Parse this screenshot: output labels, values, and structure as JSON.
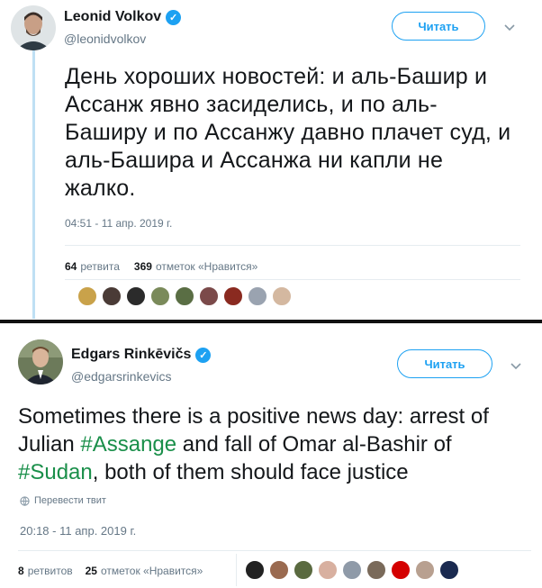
{
  "tweet1": {
    "name": "Leonid Volkov",
    "handle": "@leonidvolkov",
    "follow_label": "Читать",
    "text": "День хороших новостей: и аль-Башир и Ассанж явно засиделись, и по аль-Баширу и по Ассанжу давно плачет суд, и аль-Башира и Ассанжа ни капли не жалко.",
    "timestamp": "04:51 - 11 апр. 2019 г.",
    "retweets_count": "64",
    "retweets_label": "ретвита",
    "likes_count": "369",
    "likes_label": "отметок «Нравится»",
    "liker_colors": [
      "#c9a24a",
      "#4a3b36",
      "#2b2b2b",
      "#7a8a5a",
      "#5a6e44",
      "#7b4a4a",
      "#8a2a20",
      "#9aa3b0",
      "#d4b8a0"
    ]
  },
  "tweet2": {
    "name": "Edgars Rinkēvičs",
    "handle": "@edgarsrinkevics",
    "follow_label": "Читать",
    "text_part1": "Sometimes there is a positive news day: arrest of Julian ",
    "hashtag1": "#Assange",
    "text_part2": " and fall of Omar al-Bashir of ",
    "hashtag2": "#Sudan",
    "text_part3": ",  both of them should face justice",
    "translate_label": "Перевести твит",
    "timestamp": "20:18 - 11 апр. 2019 г.",
    "retweets_count": "8",
    "retweets_label": "ретвитов",
    "likes_count": "25",
    "likes_label": "отметок «Нравится»",
    "liker_colors": [
      "#222222",
      "#9a6a50",
      "#5a6a40",
      "#d8b0a0",
      "#8f9aa8",
      "#7a6a5a",
      "#d40000",
      "#b8a090",
      "#1a2a50"
    ]
  },
  "colors": {
    "accent": "#1da1f2",
    "hashtag": "#1a8f4a",
    "muted": "#657786"
  }
}
